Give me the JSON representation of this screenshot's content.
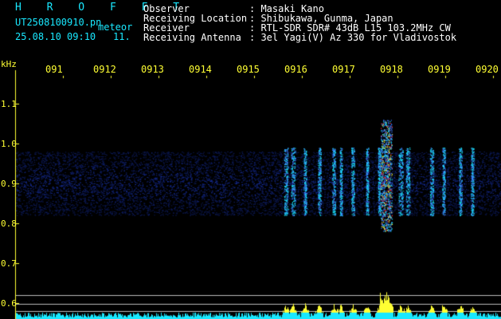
{
  "header": {
    "station": "H R O F F T",
    "filename": "UT2508100910.pn",
    "mode": "meteor",
    "datetime": "25.08.10 09:10",
    "count": "11.",
    "info": [
      {
        "label": "Observer",
        "value": ": Masaki Kano"
      },
      {
        "label": "Receiving Location",
        "value": ": Shibukawa, Gunma, Japan"
      },
      {
        "label": "Receiver",
        "value": ": RTL-SDR SDR# 43dB L15 103.2MHz CW"
      },
      {
        "label": "Receiving Antenna",
        "value": ": 3el Yagi(V) Az 330 for Vladivostok"
      }
    ]
  },
  "chart_data": {
    "type": "heatmap",
    "ylabel": "kHz",
    "x_ticks": [
      "091",
      "0912",
      "0913",
      "0914",
      "0915",
      "0916",
      "0917",
      "0918",
      "0919",
      "0920"
    ],
    "y_ticks": [
      "1.1",
      "1.0",
      "0.9",
      "0.8",
      "0.7",
      "0.6"
    ],
    "noise_band_khz": [
      0.82,
      0.98
    ],
    "meteor_echoes_minute": [
      5.65,
      5.8,
      6.05,
      6.35,
      6.65,
      6.8,
      7.05,
      7.35,
      7.6,
      7.75,
      8.05,
      8.2,
      8.7,
      8.95,
      9.3,
      9.55
    ],
    "strongest_echo_minute": 7.75,
    "colors": {
      "background": "#000000",
      "noise": "#1a2fa8",
      "echo": "#19e8ff",
      "peak": "#ff2020",
      "labels": "#ffff33"
    }
  }
}
